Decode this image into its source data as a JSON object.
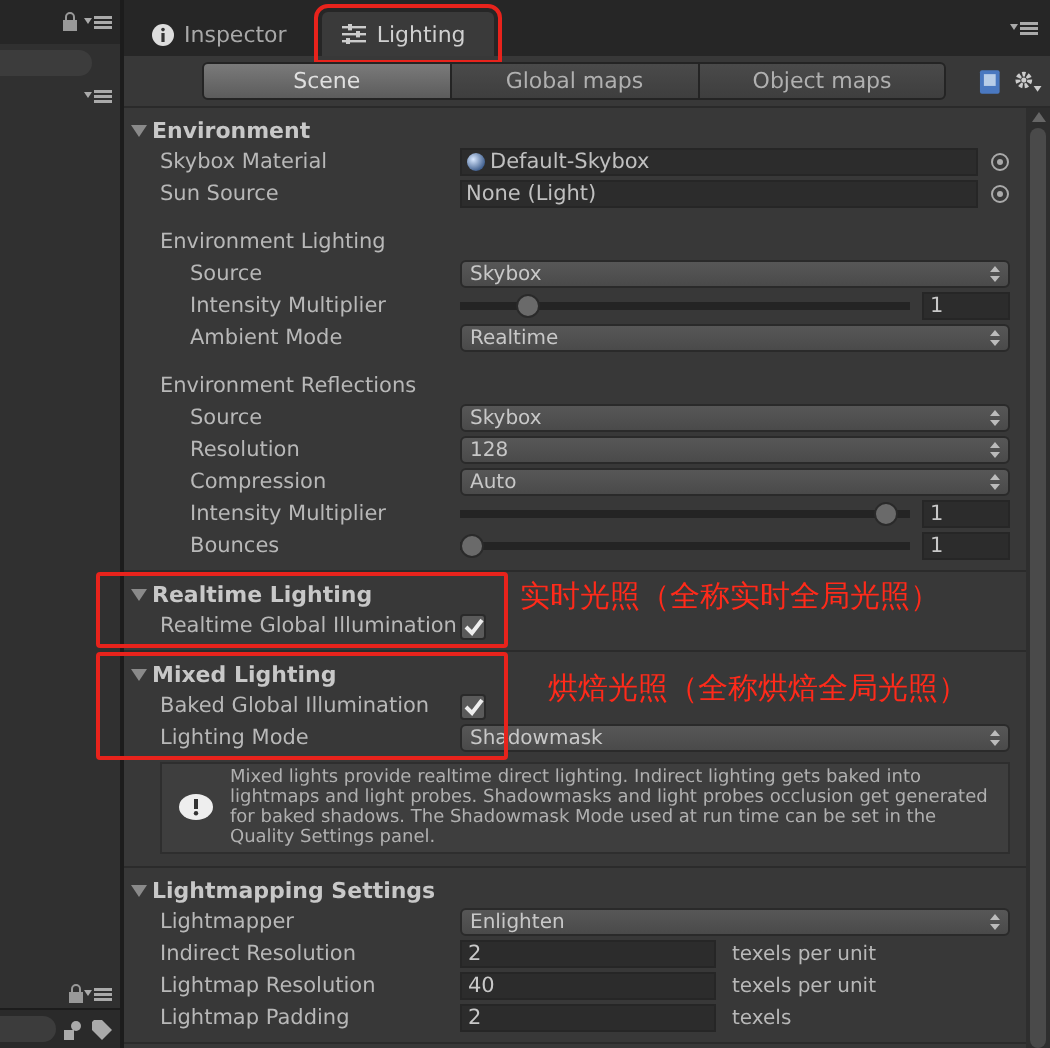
{
  "tabs": [
    {
      "label": "Inspector",
      "selected": false,
      "highlighted": false
    },
    {
      "label": "Lighting",
      "selected": true,
      "highlighted": true
    }
  ],
  "subtabs": [
    {
      "label": "Scene",
      "selected": true
    },
    {
      "label": "Global maps",
      "selected": false
    },
    {
      "label": "Object maps",
      "selected": false
    }
  ],
  "sections": [
    {
      "title": "Environment",
      "highlighted": false,
      "items": [
        {
          "kind": "material",
          "label": "Skybox Material",
          "value": "Default-Skybox"
        },
        {
          "kind": "object",
          "label": "Sun Source",
          "value": "None (Light)"
        },
        {
          "kind": "group",
          "label": "Environment Lighting",
          "children": [
            {
              "kind": "dropdown",
              "label": "Source",
              "value": "Skybox"
            },
            {
              "kind": "slider",
              "label": "Intensity Multiplier",
              "level": 0.13,
              "value": "1"
            },
            {
              "kind": "dropdown",
              "label": "Ambient Mode",
              "value": "Realtime"
            }
          ]
        },
        {
          "kind": "group",
          "label": "Environment Reflections",
          "children": [
            {
              "kind": "dropdown",
              "label": "Source",
              "value": "Skybox"
            },
            {
              "kind": "dropdown",
              "label": "Resolution",
              "value": "128"
            },
            {
              "kind": "dropdown",
              "label": "Compression",
              "value": "Auto"
            },
            {
              "kind": "slider",
              "label": "Intensity Multiplier",
              "level": 0.97,
              "value": "1"
            },
            {
              "kind": "slider",
              "label": "Bounces",
              "level": 0,
              "value": "1"
            }
          ]
        }
      ]
    },
    {
      "title": "Realtime Lighting",
      "highlighted": true,
      "note": "实时光照（全称实时全局光照）",
      "items": [
        {
          "kind": "checkbox",
          "label": "Realtime Global Illumination",
          "checked": true
        }
      ]
    },
    {
      "title": "Mixed Lighting",
      "highlighted": true,
      "note": "烘焙光照（全称烘焙全局光照）",
      "items": [
        {
          "kind": "checkbox",
          "label": "Baked Global Illumination",
          "checked": true
        },
        {
          "kind": "dropdown",
          "label": "Lighting Mode",
          "value": "Shadowmask"
        },
        {
          "kind": "info",
          "text": "Mixed lights provide realtime direct lighting. Indirect lighting gets baked into lightmaps and light probes. Shadowmasks and light probes occlusion get generated for baked shadows. The Shadowmask Mode used at run time can be set in the Quality Settings panel."
        }
      ]
    },
    {
      "title": "Lightmapping Settings",
      "highlighted": false,
      "items": [
        {
          "kind": "dropdown",
          "label": "Lightmapper",
          "value": "Enlighten"
        },
        {
          "kind": "number",
          "label": "Indirect Resolution",
          "value": "2",
          "unit": "texels per unit"
        },
        {
          "kind": "number",
          "label": "Lightmap Resolution",
          "value": "40",
          "unit": "texels per unit"
        },
        {
          "kind": "number",
          "label": "Lightmap Padding",
          "value": "2",
          "unit": "texels"
        }
      ]
    }
  ]
}
